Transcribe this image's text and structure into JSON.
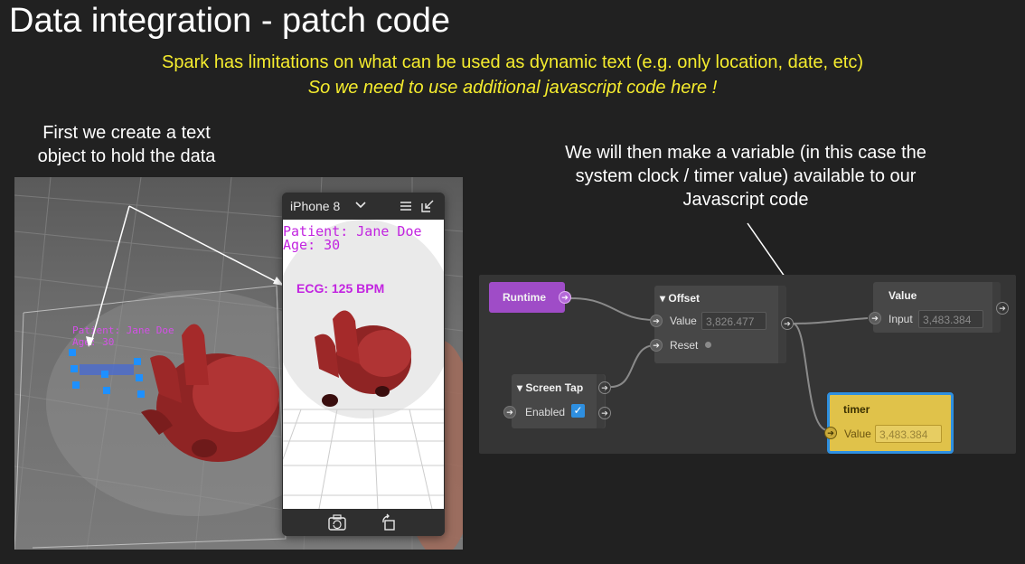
{
  "slide": {
    "title": "Data integration - patch code",
    "subtitle_line1": "Spark has limitations on what can be used as dynamic text (e.g. only location, date, etc)",
    "subtitle_line2": "So we need to use additional javascript code here !",
    "note_left": "First we create a text object to hold the data",
    "note_right": "We will then make a variable (in this case the system clock / timer value) available to our Javascript code"
  },
  "viewport": {
    "text_object": "Patient: Jane Doe\nAge: 30"
  },
  "preview": {
    "device": "iPhone 8",
    "patient_text": "Patient: Jane Doe\nAge: 30",
    "ecg_text": "ECG: 125 BPM",
    "icons": [
      "chevron-down-icon",
      "menu-icon",
      "collapse-icon",
      "camera-switch-icon",
      "rotate-icon"
    ]
  },
  "patch_editor": {
    "runtime": {
      "title": "Runtime"
    },
    "offset": {
      "title": "Offset",
      "value_label": "Value",
      "value": "3,826.477",
      "reset_label": "Reset"
    },
    "value_node": {
      "title": "Value",
      "input_label": "Input",
      "input": "3,483.384"
    },
    "screen_tap": {
      "title": "Screen Tap",
      "enabled_label": "Enabled",
      "enabled": true
    },
    "timer": {
      "title": "timer",
      "value_label": "Value",
      "value": "3,483.384"
    }
  },
  "colors": {
    "title": "#ffffff",
    "subtitle": "#f5ec2e",
    "preview_text": "#c224e0",
    "runtime_node": "#9f4cc7",
    "timer_node": "#e0c24a",
    "selection": "#2e8fe0"
  }
}
